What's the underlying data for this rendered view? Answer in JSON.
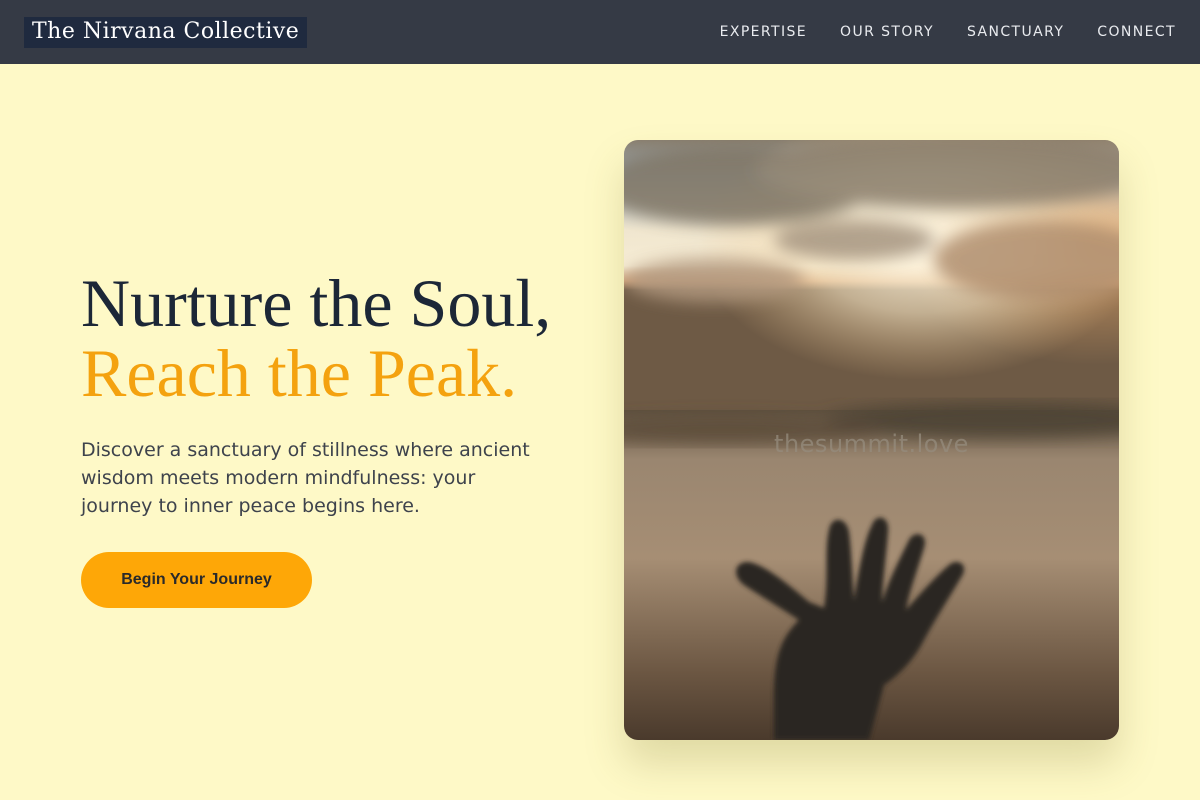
{
  "brand": {
    "name": "The Nirvana Collective"
  },
  "nav": {
    "items": [
      {
        "label": "EXPERTISE"
      },
      {
        "label": "OUR STORY"
      },
      {
        "label": "SANCTUARY"
      },
      {
        "label": "CONNECT"
      }
    ]
  },
  "hero": {
    "headline_line1": "Nurture the Soul,",
    "headline_line2": "Reach the Peak.",
    "lead": "Discover a sanctuary of stillness where ancient wisdom meets modern mindfulness: your journey to inner peace begins here.",
    "cta_label": "Begin Your Journey"
  },
  "photo": {
    "subject": "hand-reaching-toward-sunset-sky",
    "watermark": "thesummit.love"
  },
  "colors": {
    "header_bg": "#353a45",
    "page_bg": "#fef9c7",
    "accent": "#f4a20f",
    "button": "#fea707",
    "headline": "#1c2737"
  }
}
